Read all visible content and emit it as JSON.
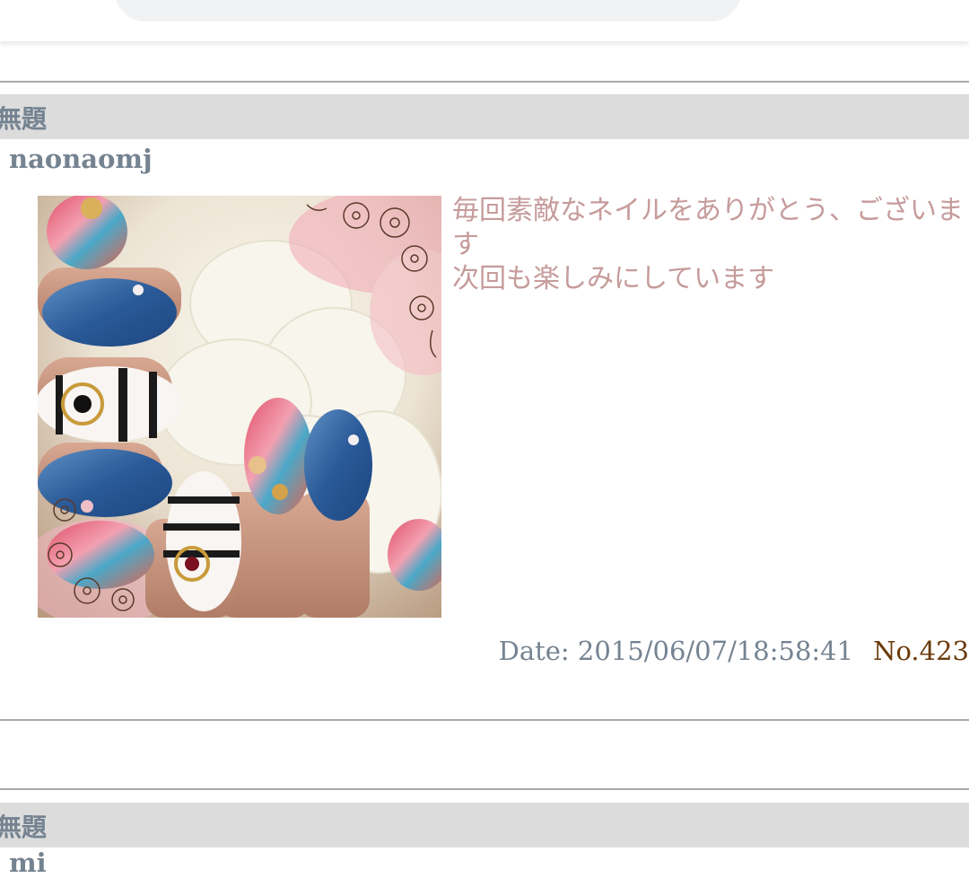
{
  "posts": [
    {
      "title": "無題",
      "author": "naonaomj",
      "message_lines": [
        "毎回素敵なネイルをありがとう、ございます",
        "次回も楽しみにしています"
      ],
      "date": "Date: 2015/06/07/18:58:41",
      "number": "No.423"
    },
    {
      "title": "無題",
      "author": "mi"
    }
  ],
  "colors": {
    "title_bar": "#dcdcdc",
    "label_gray": "#758391",
    "message_pink": "#c69b9b",
    "number_brown": "#6b3a0b"
  }
}
